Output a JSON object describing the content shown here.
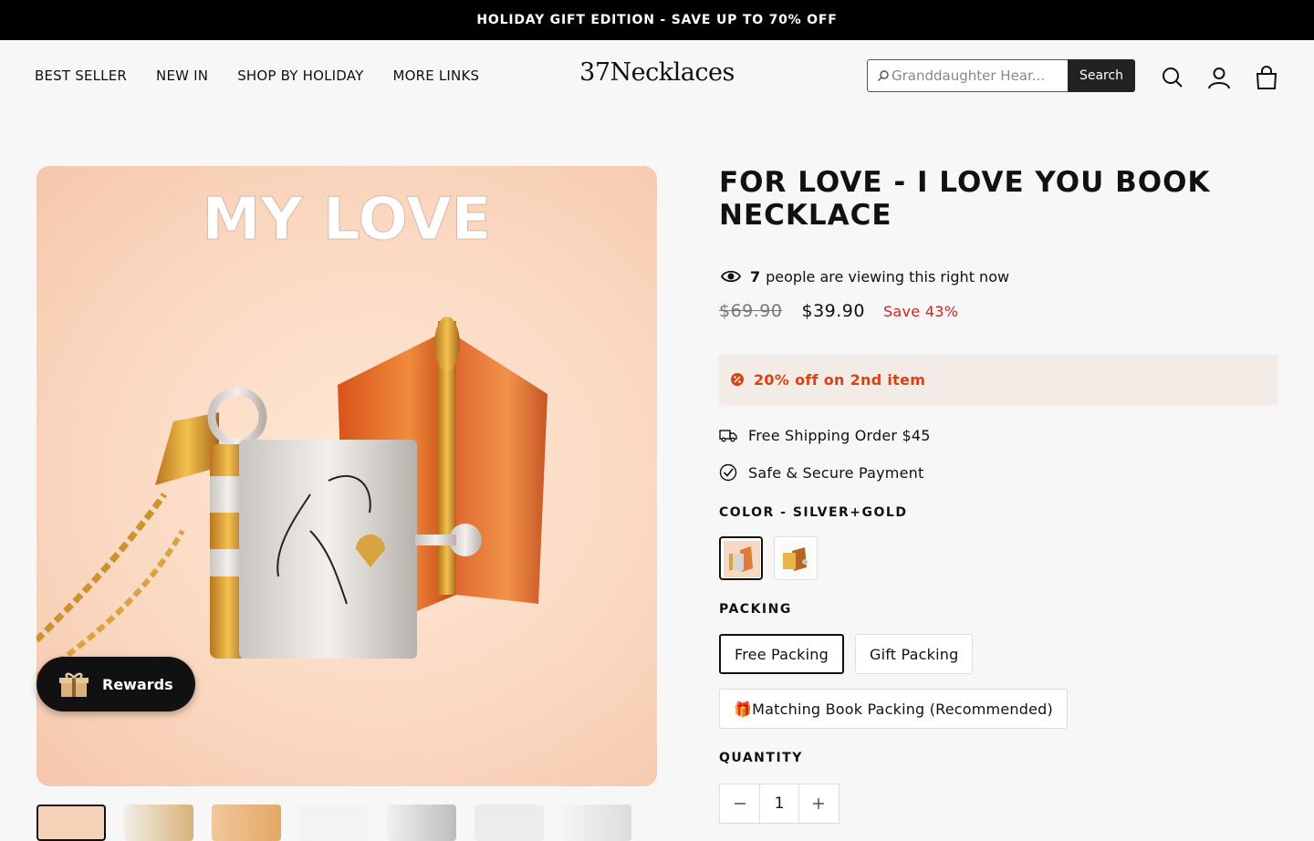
{
  "announcement": "HOLIDAY GIFT EDITION - SAVE UP TO 70% OFF",
  "nav": [
    "BEST SELLER",
    "NEW IN",
    "SHOP BY HOLIDAY",
    "MORE LINKS"
  ],
  "logo": "37Necklaces",
  "search": {
    "placeholder": "Granddaughter Hear...",
    "button": "Search"
  },
  "header_icons": [
    "search-icon",
    "account-icon",
    "cart-icon"
  ],
  "gallery": {
    "image_text": "MY LOVE",
    "thumbnail_count": 7
  },
  "rewards": "Rewards",
  "product": {
    "title": "FOR LOVE - I LOVE YOU BOOK NECKLACE",
    "viewers_count": "7",
    "viewers_text": "people are viewing this right now",
    "compare_price": "$69.90",
    "price": "$39.90",
    "save": "Save 43%",
    "promo": "20% off on 2nd item",
    "features": [
      "Free Shipping Order $45",
      "Safe & Secure Payment"
    ],
    "color_label": "COLOR - SILVER+GOLD",
    "color_options": [
      "Silver+Gold",
      "Gold"
    ],
    "packing_label": "PACKING",
    "packing_options": [
      "Free Packing",
      "Gift Packing",
      "🎁Matching Book Packing (Recommended)"
    ],
    "quantity_label": "QUANTITY",
    "quantity": "1"
  },
  "colors": {
    "announcement_bg": "#000000",
    "sale_red": "#c62828",
    "promo_orange": "#d84315",
    "page_bg": "#f7f7f7"
  }
}
